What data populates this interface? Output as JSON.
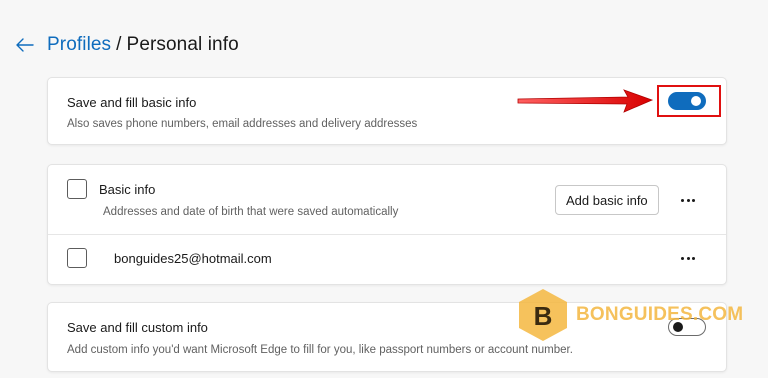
{
  "header": {
    "back_icon": "arrow-left-icon",
    "breadcrumb_parent": "Profiles",
    "separator": "/",
    "breadcrumb_current": "Personal info"
  },
  "basic_fill": {
    "title": "Save and fill basic info",
    "description": "Also saves phone numbers, email addresses and delivery addresses",
    "toggle_on": true
  },
  "basic_info": {
    "title": "Basic info",
    "description": "Addresses and date of birth that were saved automatically",
    "add_button": "Add basic info",
    "more_icon": "more-options-icon",
    "entries": [
      {
        "label": "bonguides25@hotmail.com"
      }
    ]
  },
  "custom_fill": {
    "title": "Save and fill custom info",
    "description": "Add custom info you'd want Microsoft Edge to fill for you, like passport numbers or account number.",
    "toggle_on": false
  },
  "watermark": {
    "text": "BONGUIDES.COM",
    "logo_letter": "B"
  },
  "colors": {
    "accent": "#0f6cbd",
    "annotation": "#e01010",
    "watermark": "#f4b740"
  }
}
